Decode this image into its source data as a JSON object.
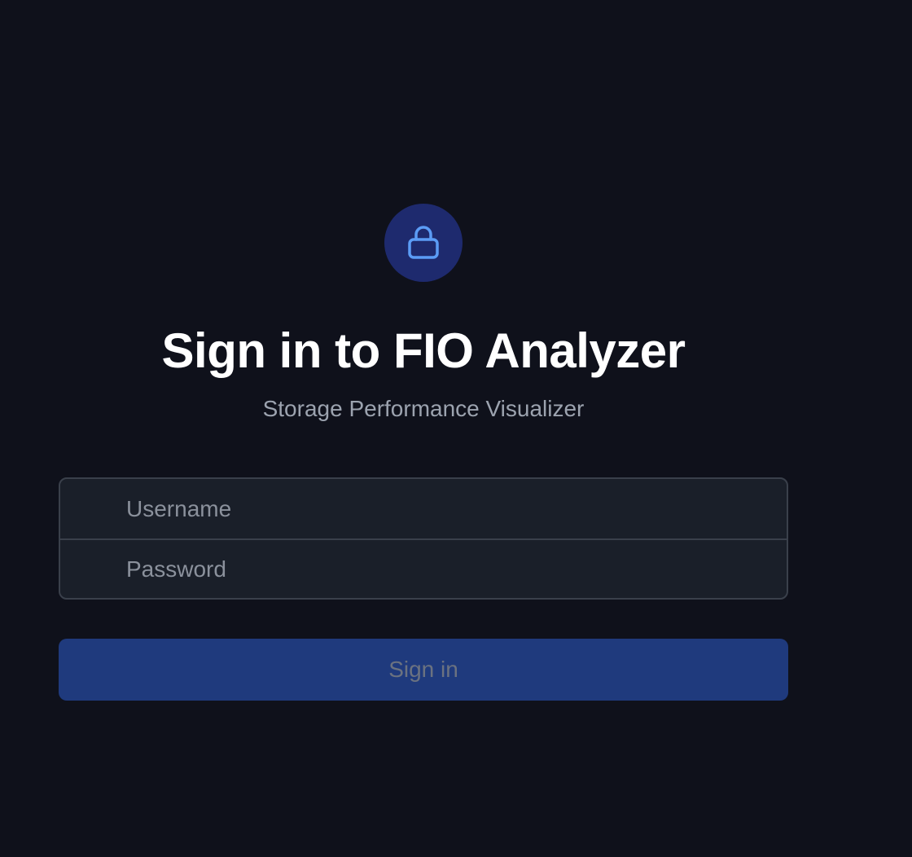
{
  "header": {
    "icon": "lock-icon",
    "title": "Sign in to FIO Analyzer",
    "subtitle": "Storage Performance Visualizer"
  },
  "form": {
    "username": {
      "value": "",
      "placeholder": "Username"
    },
    "password": {
      "value": "",
      "placeholder": "Password"
    },
    "submit_label": "Sign in"
  },
  "colors": {
    "background": "#0f111b",
    "icon_badge": "#1e2a6e",
    "icon_stroke": "#5b9cf6",
    "input_background": "#1a1f29",
    "input_border": "#3a404b",
    "button_background": "#1f3a7d",
    "button_text": "#6b7280",
    "title_text": "#ffffff",
    "subtitle_text": "#9ca3af"
  }
}
